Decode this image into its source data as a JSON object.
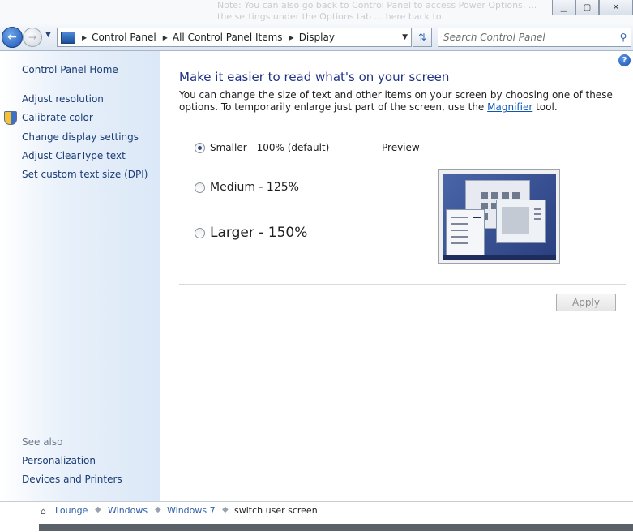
{
  "background_window": {
    "note_text": "Note: You can also go back to Control Panel to access Power Options. ... the settings under the Options tab ... here back to",
    "controls": {
      "minimize": "▁",
      "maximize": "▢",
      "close": "✕"
    }
  },
  "navbar": {
    "back_icon": "back-arrow-icon",
    "breadcrumbs": [
      "Control Panel",
      "All Control Panel Items",
      "Display"
    ],
    "search_placeholder": "Search Control Panel"
  },
  "sidebar": {
    "home": "Control Panel Home",
    "tasks": [
      "Adjust resolution",
      "Calibrate color",
      "Change display settings",
      "Adjust ClearType text",
      "Set custom text size (DPI)"
    ],
    "see_also_label": "See also",
    "see_also": [
      "Personalization",
      "Devices and Printers"
    ]
  },
  "main": {
    "title": "Make it easier to read what's on your screen",
    "desc_part1": "You can change the size of text and other items on your screen by choosing one of these options. To temporarily enlarge just part of the screen, use the ",
    "desc_link": "Magnifier",
    "desc_part2": " tool.",
    "options": [
      {
        "label": "Smaller - 100% (default)",
        "selected": true
      },
      {
        "label": "Medium - 125%",
        "selected": false
      },
      {
        "label": "Larger - 150%",
        "selected": false
      }
    ],
    "preview_label": "Preview",
    "apply_label": "Apply",
    "help_glyph": "?"
  },
  "bottom_page": {
    "breadcrumbs": [
      "Lounge",
      "Windows",
      "Windows 7",
      "switch user screen"
    ]
  }
}
